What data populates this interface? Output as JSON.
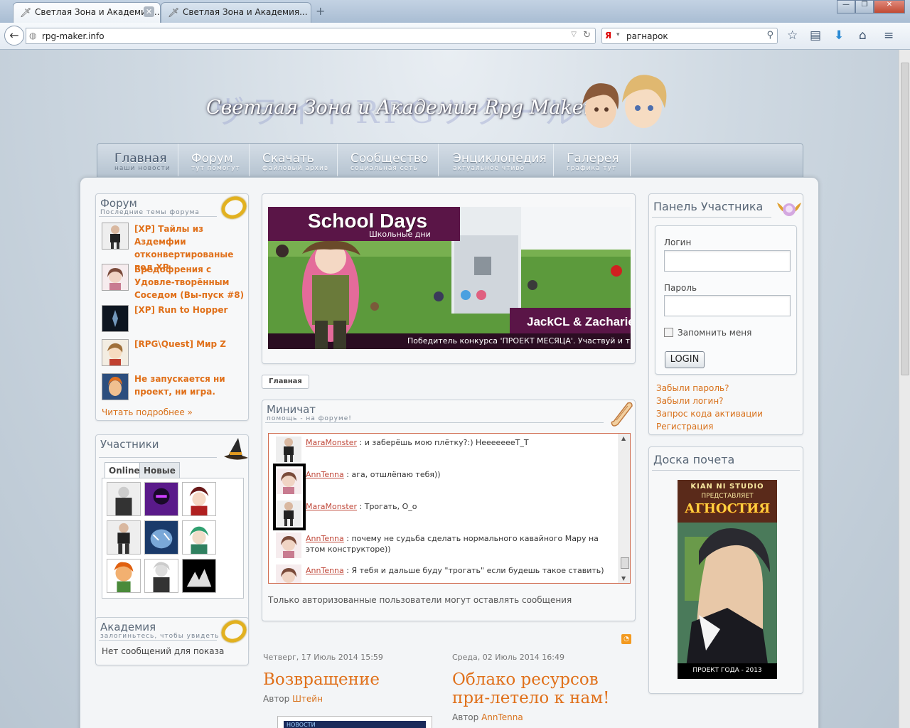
{
  "browser": {
    "tabs": [
      {
        "title": "Светлая Зона и Академия...",
        "active": true
      },
      {
        "title": "Светлая Зона и Академия...",
        "active": false
      }
    ],
    "new_tab": "+",
    "url": "rpg-maker.info",
    "search_engine": "Я",
    "search_query": "рагнарок",
    "window_buttons": {
      "min": "—",
      "max": "❐",
      "close": "✕"
    }
  },
  "site": {
    "title": "Светлая Зона и Академия Rpg Maker",
    "logo_watermark": "ヴライトRPGツクール"
  },
  "nav": [
    {
      "label": "Главная",
      "sub": "наши новости"
    },
    {
      "label": "Форум",
      "sub": "тут помогут"
    },
    {
      "label": "Скачать",
      "sub": "файловый архив"
    },
    {
      "label": "Сообщество",
      "sub": "социальная сеть"
    },
    {
      "label": "Энциклопедия",
      "sub": "актуальное чтиво"
    },
    {
      "label": "Галерея",
      "sub": "графика тут"
    }
  ],
  "forum": {
    "title": "Форум",
    "subtitle": "Последние темы форума",
    "items": [
      {
        "title": "[XP] Тайлы из Аздемфии отконвертированые под XP"
      },
      {
        "title": "Бредофрения с Удовле-творённым Соседом (Вы-пуск #8)"
      },
      {
        "title": "[XP] Run to Hopper"
      },
      {
        "title": "[RPG\\Quest] Мир Z"
      },
      {
        "title": "Не запускается ни проект, ни игра."
      }
    ],
    "more": "Читать подробнее »"
  },
  "users": {
    "title": "Участники",
    "tabs": [
      "Online",
      "Новые"
    ]
  },
  "academy": {
    "title": "Академия",
    "subtitle": "залогиньтесь, чтобы увидеть",
    "empty": "Нет сообщений для показа"
  },
  "banner": {
    "title": "School Days",
    "subtitle": "Школьные дни",
    "authors": "JackCL & Zacharie",
    "caption": "Победитель конкурса 'ПРОЕКТ МЕСЯЦА'. Участвуй и ты"
  },
  "breadcrumb": "Главная",
  "minichat": {
    "title": "Миничат",
    "subtitle": "помощь - на форуме!",
    "messages": [
      {
        "user": "MaraMonster",
        "text": " : и заберёшь мою плётку?:) НеееееееТ_Т"
      },
      {
        "user": "AnnTenna",
        "text": " : ага, отшлёпаю тебя))"
      },
      {
        "user": "MaraMonster",
        "text": " : Трогать, О_о"
      },
      {
        "user": "AnnTenna",
        "text": " : почему не судьба сделать нормального кавайного Мару на этом конструкторе))"
      },
      {
        "user": "AnnTenna",
        "text": " : Я тебя и дальше буду \"трогать\" если будешь такое ставить)"
      }
    ],
    "notice": "Только авторизованные пользователи могут оставлять сообщения"
  },
  "articles": [
    {
      "date": "Четверг, 17 Июль 2014 15:59",
      "title": "Возвращение",
      "author_label": "Автор",
      "author": "Штейн"
    },
    {
      "date": "Среда, 02 Июль 2014 16:49",
      "title": "Облако ресурсов при-летело к нам!",
      "author_label": "Автор",
      "author": "AnnTenna"
    }
  ],
  "article_thumb_text": "НОВОСТИ",
  "login": {
    "title": "Панель Участника",
    "login_label": "Логин",
    "password_label": "Пароль",
    "remember": "Запомнить меня",
    "button": "LOGIN",
    "links": [
      "Забыли пароль?",
      "Забыли логин?",
      "Запрос кода активации",
      "Регистрация"
    ]
  },
  "honor": {
    "title": "Доска почета",
    "poster_top1": "KIAN NI STUDIO",
    "poster_top2": "ПРЕДСТАВЛЯЕТ",
    "poster_title": "АГНОСТИЯ",
    "poster_bottom": "ПРОЕКТ ГОДА - 2013"
  },
  "colors": {
    "accent": "#e0701a",
    "chat_user": "#c0483a",
    "banner_purple": "#5a1547"
  }
}
